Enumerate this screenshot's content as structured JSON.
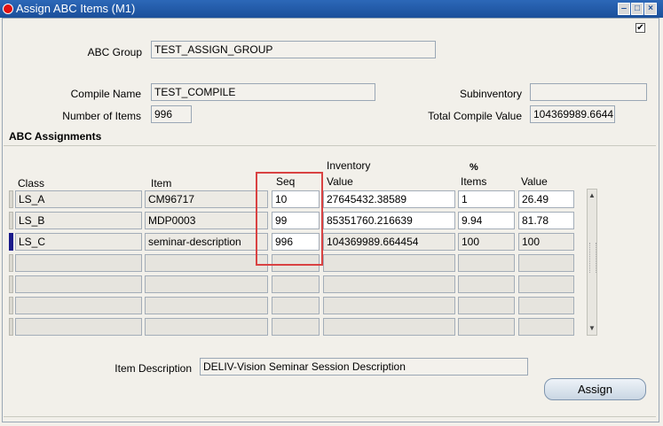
{
  "window": {
    "title": "Assign ABC Items (M1)",
    "controls": {
      "minimize": "‒",
      "maximize": "□",
      "close": "×"
    }
  },
  "header": {
    "abc_group_label": "ABC Group",
    "abc_group_value": "TEST_ASSIGN_GROUP",
    "compile_name_label": "Compile Name",
    "compile_name_value": "TEST_COMPILE",
    "subinventory_label": "Subinventory",
    "subinventory_value": "",
    "number_of_items_label": "Number of Items",
    "number_of_items_value": "996",
    "total_compile_value_label": "Total Compile Value",
    "total_compile_value_value": "104369989.6644",
    "checkbox_checked": "✔"
  },
  "assignments": {
    "section_title": "ABC Assignments",
    "headers": {
      "class": "Class",
      "item": "Item",
      "seq": "Seq",
      "inventory_top": "Inventory",
      "inventory_value": "Value",
      "percent_top": "%",
      "percent_items": "Items",
      "percent_value": "Value"
    },
    "rows": [
      {
        "class": "LS_A",
        "item": "CM96717",
        "seq": "10",
        "inv_value": "27645432.38589",
        "pct_items": "1",
        "pct_value": "26.49"
      },
      {
        "class": "LS_B",
        "item": "MDP0003",
        "seq": "99",
        "inv_value": "85351760.216639",
        "pct_items": "9.94",
        "pct_value": "81.78"
      },
      {
        "class": "LS_C",
        "item": "seminar-description",
        "seq": "996",
        "inv_value": "104369989.664454",
        "pct_items": "100",
        "pct_value": "100"
      }
    ]
  },
  "footer": {
    "item_description_label": "Item Description",
    "item_description_value": "DELIV-Vision Seminar Session Description",
    "assign_button": "Assign"
  },
  "colors": {
    "titlebar": "#1b4f9a",
    "highlight_box": "#d94242",
    "current_row_marker": "#1a1a8a"
  }
}
